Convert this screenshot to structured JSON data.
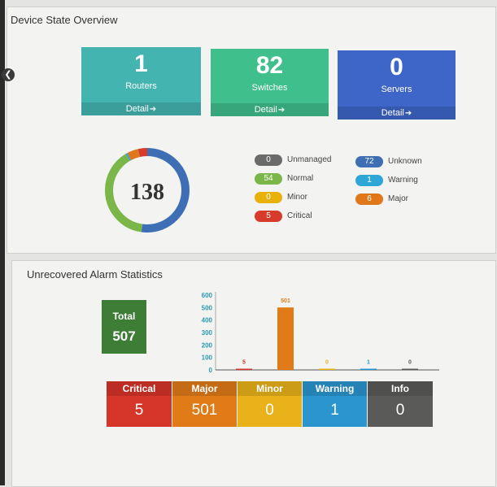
{
  "device_overview": {
    "title": "Device State Overview",
    "nav_icon": "chevron-left-icon",
    "tiles": [
      {
        "count": "1",
        "label": "Routers",
        "detail": "Detail",
        "color": "#44b4b0"
      },
      {
        "count": "82",
        "label": "Switches",
        "detail": "Detail",
        "color": "#3fbf8c"
      },
      {
        "count": "0",
        "label": "Servers",
        "detail": "Detail",
        "color": "#3e66c9"
      }
    ],
    "total": "138",
    "legend": [
      {
        "count": "0",
        "label": "Unmanaged",
        "color": "#6b6b6b"
      },
      {
        "count": "72",
        "label": "Unknown",
        "color": "#3e6fb5"
      },
      {
        "count": "54",
        "label": "Normal",
        "color": "#7ab648"
      },
      {
        "count": "1",
        "label": "Warning",
        "color": "#2ea6d6"
      },
      {
        "count": "0",
        "label": "Minor",
        "color": "#e8b10c"
      },
      {
        "count": "6",
        "label": "Major",
        "color": "#e0771b"
      },
      {
        "count": "5",
        "label": "Critical",
        "color": "#d73b2c"
      }
    ]
  },
  "alarm_statistics": {
    "title": "Unrecovered Alarm Statistics",
    "total_label": "Total",
    "total_value": "507",
    "severities": [
      {
        "label": "Critical",
        "value": "5",
        "color": "#d6352a"
      },
      {
        "label": "Major",
        "value": "501",
        "color": "#e07b18"
      },
      {
        "label": "Minor",
        "value": "0",
        "color": "#e9b21b"
      },
      {
        "label": "Warning",
        "value": "1",
        "color": "#2b95cf"
      },
      {
        "label": "Info",
        "value": "0",
        "color": "#5a5a58"
      }
    ]
  },
  "chart_data": {
    "type": "bar",
    "categories": [
      "Critical",
      "Major",
      "Minor",
      "Warning",
      "Info"
    ],
    "values": [
      5,
      501,
      0,
      1,
      0
    ],
    "colors": [
      "#d6352a",
      "#e07b18",
      "#e9b21b",
      "#2b95cf",
      "#5a5a58"
    ],
    "y_ticks": [
      0,
      100,
      200,
      300,
      400,
      500,
      600
    ],
    "ylim": [
      0,
      600
    ],
    "grid": false,
    "title": "",
    "xlabel": "",
    "ylabel": ""
  }
}
